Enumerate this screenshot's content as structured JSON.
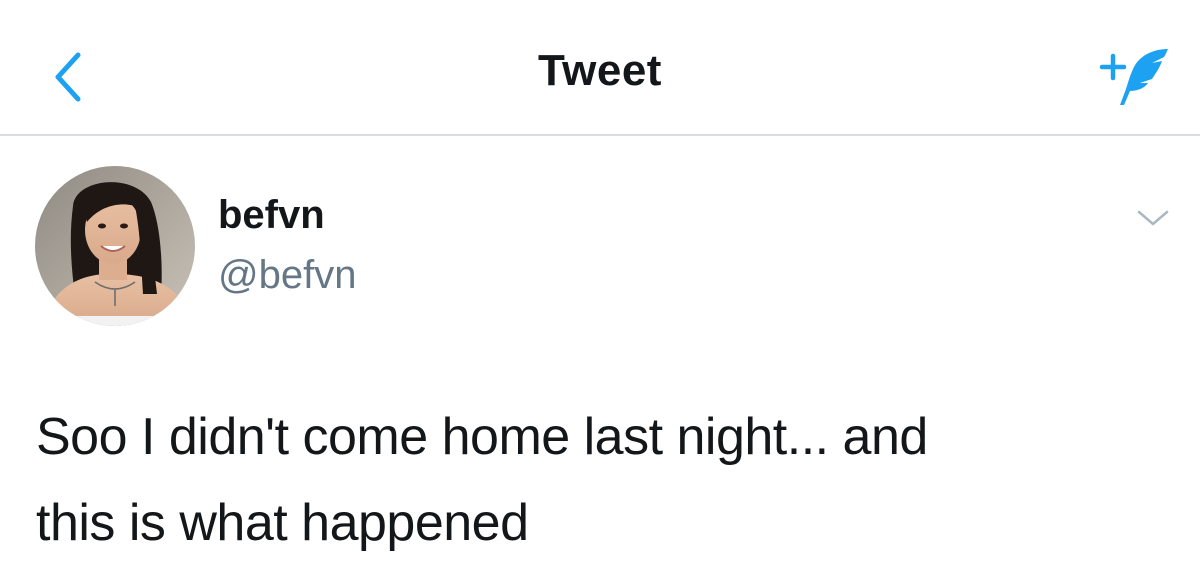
{
  "header": {
    "title": "Tweet",
    "back_icon": "chevron-left-icon",
    "compose_icon": "compose-tweet-icon",
    "accent_color": "#1da1f2"
  },
  "tweet": {
    "author": {
      "name": "befvn",
      "handle": "@befvn"
    },
    "more_icon": "chevron-down-icon",
    "text_line1": "Soo I didn't come home last night... and",
    "text_line2": "this is what happened"
  }
}
